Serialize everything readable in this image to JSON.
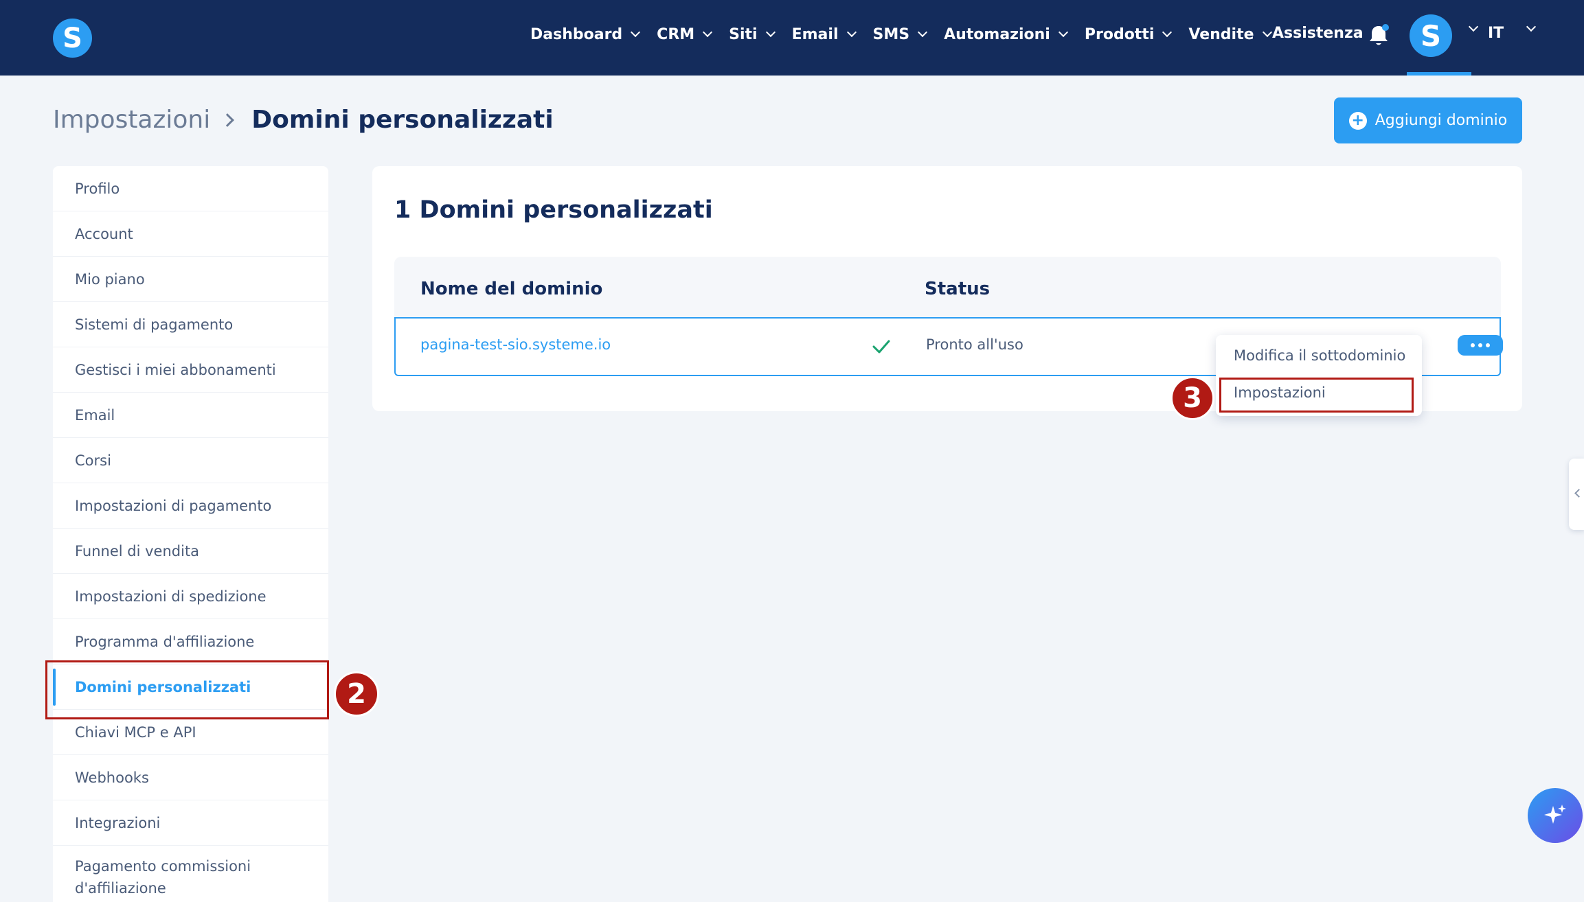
{
  "nav": {
    "logo_letter": "S",
    "items": [
      {
        "label": "Dashboard"
      },
      {
        "label": "CRM"
      },
      {
        "label": "Siti"
      },
      {
        "label": "Email"
      },
      {
        "label": "SMS"
      },
      {
        "label": "Automazioni"
      },
      {
        "label": "Prodotti"
      },
      {
        "label": "Vendite"
      }
    ],
    "assistance": "Assistenza",
    "avatar_letter": "S",
    "language": "IT"
  },
  "breadcrumb": {
    "parent": "Impostazioni",
    "current": "Domini personalizzati"
  },
  "actions": {
    "add_domain": "Aggiungi dominio",
    "plus_glyph": "+"
  },
  "sidebar": {
    "items": [
      {
        "label": "Profilo"
      },
      {
        "label": "Account"
      },
      {
        "label": "Mio piano"
      },
      {
        "label": "Sistemi di pagamento"
      },
      {
        "label": "Gestisci i miei abbonamenti"
      },
      {
        "label": "Email"
      },
      {
        "label": "Corsi"
      },
      {
        "label": "Impostazioni di pagamento"
      },
      {
        "label": "Funnel di vendita"
      },
      {
        "label": "Impostazioni di spedizione"
      },
      {
        "label": "Programma d'affiliazione"
      },
      {
        "label": "Domini personalizzati"
      },
      {
        "label": "Chiavi MCP e API"
      },
      {
        "label": "Webhooks"
      },
      {
        "label": "Integrazioni"
      },
      {
        "label": "Pagamento commissioni d'affiliazione"
      }
    ],
    "active_index": 11
  },
  "main": {
    "title": "1 Domini personalizzati",
    "columns": {
      "domain": "Nome del dominio",
      "status": "Status"
    },
    "rows": [
      {
        "domain": "pagina-test-sio.systeme.io",
        "status": "Pronto all'uso"
      }
    ]
  },
  "dropdown": {
    "items": [
      {
        "label": "Modifica il sottodominio"
      },
      {
        "label": "Impostazioni"
      }
    ]
  },
  "annotations": {
    "step_sidebar": "2",
    "step_dropdown": "3"
  },
  "colors": {
    "nav_bg": "#142c5c",
    "accent": "#2c9df2",
    "highlight": "#b11a14",
    "success": "#1aa36f"
  }
}
